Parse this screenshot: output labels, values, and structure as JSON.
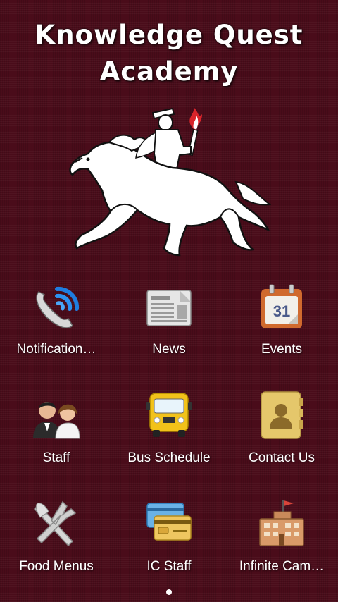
{
  "app": {
    "title_line1": "Knowledge Quest",
    "title_line2": "Academy"
  },
  "colors": {
    "background": "#4a0c1a",
    "text": "#ffffff"
  },
  "logo": {
    "icon": "horse-rider-torch-mascot-icon"
  },
  "grid": {
    "items": [
      {
        "label": "Notification…",
        "icon": "phone-notification-icon"
      },
      {
        "label": "News",
        "icon": "newspaper-icon"
      },
      {
        "label": "Events",
        "icon": "calendar-icon",
        "day": "31"
      },
      {
        "label": "Staff",
        "icon": "staff-people-icon"
      },
      {
        "label": "Bus Schedule",
        "icon": "school-bus-icon"
      },
      {
        "label": "Contact Us",
        "icon": "contact-book-icon"
      },
      {
        "label": "Food Menus",
        "icon": "fork-knife-icon"
      },
      {
        "label": "IC Staff",
        "icon": "cards-icon"
      },
      {
        "label": "Infinite Cam…",
        "icon": "school-building-icon"
      }
    ]
  },
  "pager": {
    "pages": 1,
    "current": 1
  }
}
